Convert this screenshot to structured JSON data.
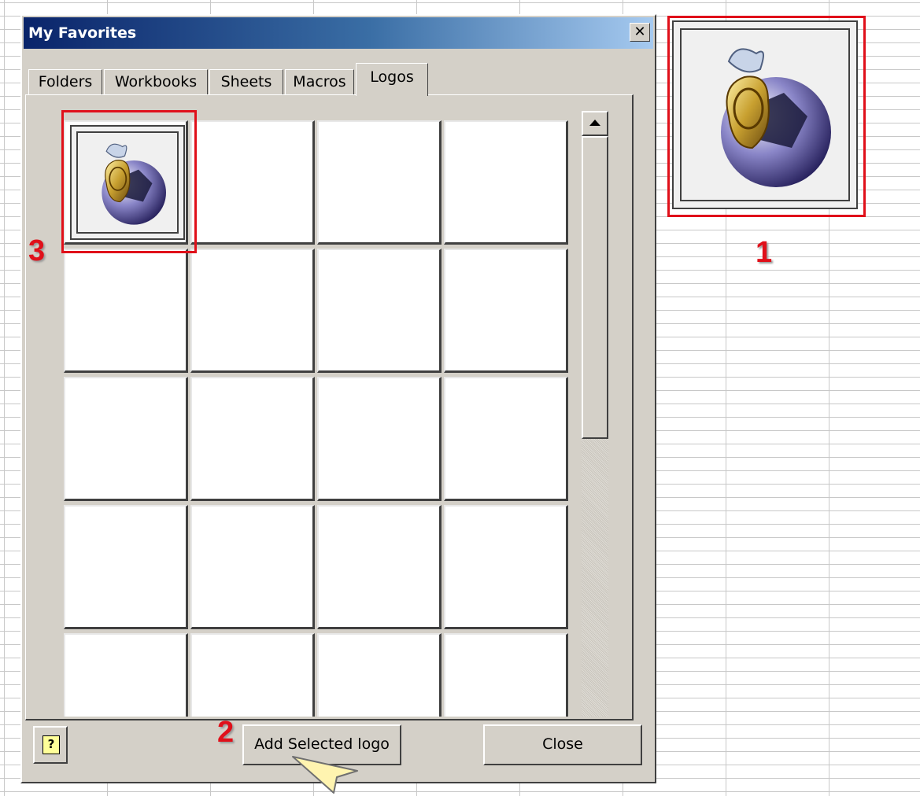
{
  "dialog": {
    "title": "My Favorites",
    "close_glyph": "✕",
    "tabs": [
      {
        "label": "Folders"
      },
      {
        "label": "Workbooks"
      },
      {
        "label": "Sheets"
      },
      {
        "label": "Macros"
      },
      {
        "label": "Logos",
        "active": true
      }
    ],
    "buttons": {
      "help_glyph": "?",
      "add_selected": "Add Selected logo",
      "close": "Close"
    },
    "grid": {
      "columns": 4,
      "rows_visible": 5,
      "filled_cells": 1
    }
  },
  "annotations": {
    "one": "1",
    "two": "2",
    "three": "3",
    "color": "#e0101a"
  },
  "icons": {
    "logo": "soccer-ball-money-bag-logo",
    "help": "help-icon",
    "close": "close-icon",
    "scroll_up": "arrow-up-icon",
    "cursor": "mouse-cursor-icon"
  }
}
